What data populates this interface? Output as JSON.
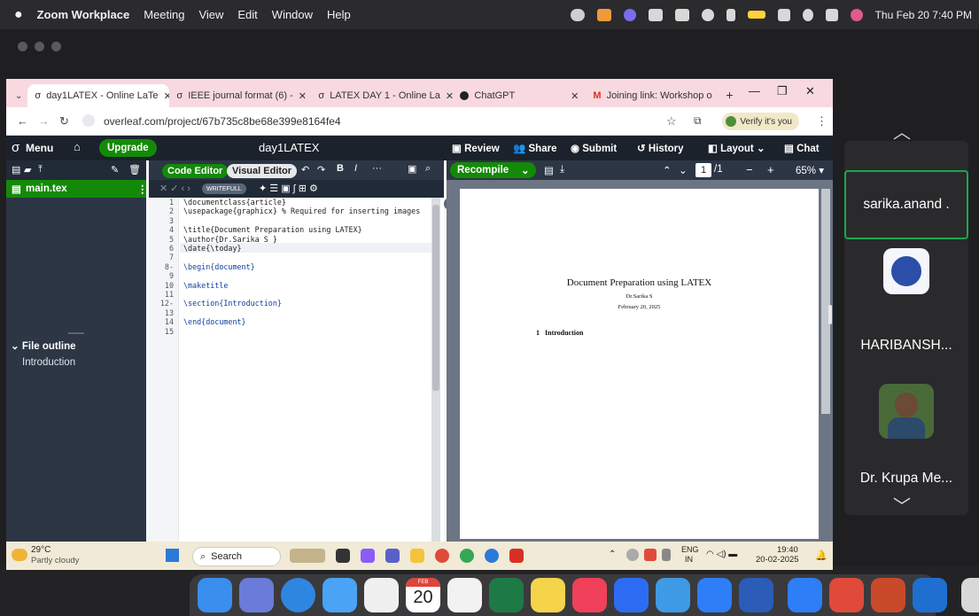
{
  "menubar": {
    "app": "Zoom Workplace",
    "items": [
      "Meeting",
      "View",
      "Edit",
      "Window",
      "Help"
    ],
    "datetime": "Thu Feb 20  7:40 PM"
  },
  "browser": {
    "tabs": [
      {
        "label": "day1LATEX - Online LaTe",
        "active": true
      },
      {
        "label": "IEEE journal format (6) - ",
        "active": false
      },
      {
        "label": "LATEX DAY 1 - Online La",
        "active": false
      },
      {
        "label": "ChatGPT",
        "active": false
      },
      {
        "label": "Joining link: Workshop o",
        "active": false
      }
    ],
    "url": "overleaf.com/project/67b735c8be68e399e8164fe4",
    "verify_label": "Verify it's you"
  },
  "overleaf": {
    "menu_label": "Menu",
    "upgrade_label": "Upgrade",
    "project_title": "day1LATEX",
    "nav": [
      "Review",
      "Share",
      "Submit",
      "History",
      "Layout",
      "Chat"
    ],
    "file": "main.tex",
    "file_outline_label": "File outline",
    "outline_items": [
      "Introduction"
    ],
    "editor_modes": [
      "Code Editor",
      "Visual Editor"
    ],
    "writefull_label": "WRITEFULL",
    "code_lines": [
      "\\documentclass{article}",
      "\\usepackage{graphicx} % Required for inserting images",
      "",
      "\\title{Document Preparation using LATEX}",
      "\\author{Dr.Sarika S }",
      "\\date{\\today}",
      "",
      "\\begin{document}",
      "",
      "\\maketitle",
      "",
      "\\section{Introduction}",
      "",
      "\\end{document}",
      ""
    ],
    "recompile_label": "Recompile",
    "page_current": "1",
    "page_total": "/1",
    "zoom_level": "65%",
    "pdf": {
      "title": "Document Preparation using LATEX",
      "author": "Dr.Sarika S",
      "date": "February 20, 2025",
      "section_num": "1",
      "section_title": "Introduction"
    }
  },
  "taskbar": {
    "weather_temp": "29°C",
    "weather_desc": "Partly cloudy",
    "search_placeholder": "Search",
    "lang": "ENG",
    "lang_region": "IN",
    "time": "19:40",
    "date": "20-02-2025",
    "calendar_badge": "FEB"
  },
  "participants": [
    {
      "name": "sarika.anand ."
    },
    {
      "name": "HARIBANSH..."
    },
    {
      "name": "Dr. Krupa Me..."
    }
  ],
  "dock": {
    "calendar_day": "20"
  },
  "colors": {
    "overleaf_green": "#138a07",
    "overleaf_dark": "#1b222c",
    "tab_strip": "#f7d9df",
    "active_speaker": "#1ba84c"
  }
}
